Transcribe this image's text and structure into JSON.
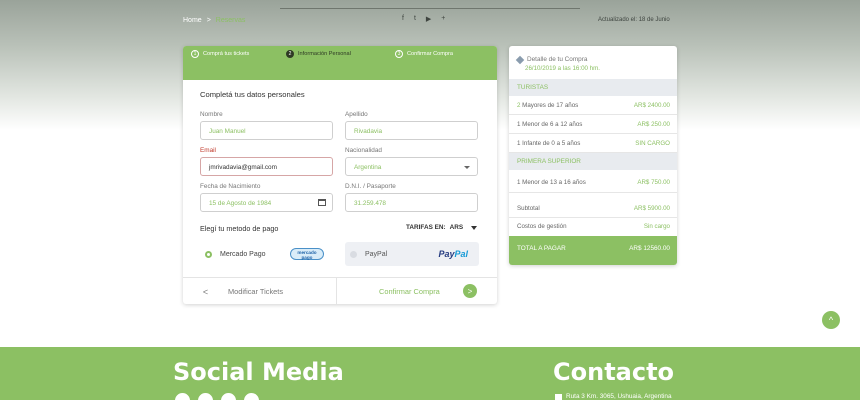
{
  "breadcrumb": {
    "home": "Home",
    "separator": ">",
    "current": "Reservas"
  },
  "top_social": [
    "facebook-icon",
    "twitter-icon",
    "youtube-icon",
    "plus-icon"
  ],
  "top_social_glyphs": [
    "f",
    "t",
    "▶",
    "+"
  ],
  "updated": "Actualizado el: 18 de Junio",
  "steps": [
    {
      "num": "1",
      "label": "Comprá tus tickets",
      "state": "done"
    },
    {
      "num": "2",
      "label": "Información Personal",
      "state": "active"
    },
    {
      "num": "3",
      "label": "Confirmar Compra",
      "state": "pending"
    }
  ],
  "form": {
    "title": "Completá tus datos personales",
    "nombre_label": "Nombre",
    "nombre_value": "Juan Manuel",
    "apellido_label": "Apellido",
    "apellido_value": "Rivadavia",
    "email_label": "Email",
    "email_value": "jmrivadavia@gmail.com",
    "nacionalidad_label": "Nacionalidad",
    "nacionalidad_value": "Argentina",
    "fecha_label": "Fecha de Nacimiento",
    "fecha_value": "15 de Agosto de 1984",
    "dni_label": "D.N.I. / Pasaporte",
    "dni_value": "31.259.478"
  },
  "payment": {
    "title": "Elegí tu metodo de pago",
    "tarifas_label": "TARIFAS EN:",
    "tarifas_currency": "ARS",
    "option1": "Mercado Pago",
    "option1_logo_line1": "mercado",
    "option1_logo_line2": "pago",
    "option2": "PayPal",
    "option2_logo_a": "Pay",
    "option2_logo_b": "Pal",
    "selected": "Mercado Pago"
  },
  "nav": {
    "prev_icon": "<",
    "prev": "Modificar Tickets",
    "next": "Confirmar Compra",
    "next_icon": ">"
  },
  "summary": {
    "title": "Detalle de tu Compra",
    "date": "26/10/2019 a las 16:00 hm.",
    "sections": [
      {
        "name": "TURISTAS",
        "rows": [
          {
            "qty": "2",
            "desc": " Mayores de 17 años",
            "price": "AR$ 2400.00"
          },
          {
            "qty": "",
            "desc": "1 Menor de 6 a 12 años",
            "price": "AR$ 250.00"
          },
          {
            "qty": "",
            "desc": "1 Infante de 0 a 5 años",
            "price": "SIN CARGO"
          }
        ]
      },
      {
        "name": "PRIMERA SUPERIOR",
        "rows": [
          {
            "qty": "",
            "desc": "1 Menor de 13 a 16 años",
            "price": "AR$ 750.00"
          }
        ]
      }
    ],
    "subtotal_label": "Subtotal",
    "subtotal_value": "AR$ 5900.00",
    "gestion_label": "Costos de gestión",
    "gestion_value": "Sin cargo",
    "total_label": "TOTAL A PAGAR",
    "total_value": "AR$ 12560.00"
  },
  "scroll_top_icon": "^",
  "footer": {
    "social_title": "Social Media",
    "contact_title": "Contacto",
    "address": "Ruta 3 Km. 3065, Ushuaia, Argentina"
  },
  "colors": {
    "accent": "#8cc063",
    "dark": "#2e3a24",
    "section_bg": "#e8ebef"
  }
}
